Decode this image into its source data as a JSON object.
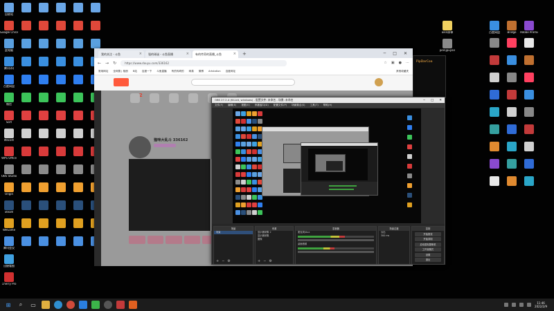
{
  "desktop": {
    "left_icons": [
      {
        "label": "回收站",
        "color": "#6aa6e6"
      },
      {
        "label": "Google Chrome",
        "color": "#e0483a"
      },
      {
        "label": "此电脑",
        "color": "#5aa0e0"
      },
      {
        "label": "腾讯QQ",
        "color": "#3a8fe0"
      },
      {
        "label": "百度网盘",
        "color": "#2f7ff0"
      },
      {
        "label": "微信",
        "color": "#3cc45a"
      },
      {
        "label": "Sort",
        "color": "#e04040"
      },
      {
        "label": "Wacom",
        "color": "#d0d0d0"
      },
      {
        "label": "WPS Office",
        "color": "#d83a3a"
      },
      {
        "label": "OBS Studio",
        "color": "#8b8b8b"
      },
      {
        "label": "Origin",
        "color": "#f0a030"
      },
      {
        "label": "Steam",
        "color": "#2a4f7a"
      },
      {
        "label": "WeGame",
        "color": "#e0a020"
      },
      {
        "label": "腾讯会议",
        "color": "#4a90e2"
      },
      {
        "label": "迅捷看图",
        "color": "#3fa0e0"
      },
      {
        "label": "Cherry Pro",
        "color": "#d03030"
      }
    ],
    "right_icons": [
      {
        "label": "百度网盘",
        "color": "#3a8fe0"
      },
      {
        "label": "ZBrush",
        "color": "#888888"
      },
      {
        "label": "Substance Painter",
        "color": "#c23a3a"
      },
      {
        "label": "Marmoset",
        "color": "#d0d0d0"
      },
      {
        "label": "Adobe Photoshop",
        "color": "#2f6bd6"
      },
      {
        "label": "3ds Max",
        "color": "#2aa6c8"
      },
      {
        "label": "Maya",
        "color": "#35a0a0"
      },
      {
        "label": "Blender",
        "color": "#e08a30"
      },
      {
        "label": "Adobe Premiere",
        "color": "#8a4ad0"
      },
      {
        "label": "Unreal",
        "color": "#e8e8e8"
      },
      {
        "label": "Bridge",
        "color": "#c07030"
      },
      {
        "label": "Toolbag",
        "color": "#ff4060"
      }
    ],
    "mid_labels": [
      "oikn原神",
      "pinnjpuyan",
      "PipDarCoa"
    ]
  },
  "browser": {
    "tabs": [
      {
        "label": "我的关注 - 斗鱼",
        "active": false
      },
      {
        "label": "强的球迷 - 斗鱼直播",
        "active": false
      },
      {
        "label": "有的传奇的直播_斗鱼",
        "active": true
      }
    ],
    "url": "https://www.douyu.com/336162",
    "bookmarks": [
      "常用网址",
      "全网搜 | 相册",
      "B站",
      "百度一下",
      "斗鱼直播",
      "有的传奇的",
      "网易",
      "微博",
      "Artstation",
      "百度网址",
      "其他收藏夹"
    ],
    "streamer_name": "猫咪大乱斗 336162",
    "stat_number": "12"
  },
  "obs": {
    "title": "OBS 27.2.4 (64-bit, windows) - 配置文件: 未命名 - 场景: 未命名",
    "menu": [
      "文件(F)",
      "编辑(E)",
      "视图(V)",
      "停靠窗口(D)",
      "配置文件(P)",
      "场景集合(S)",
      "工具(T)",
      "帮助(H)"
    ],
    "scenes_title": "场景",
    "scenes": [
      "场景"
    ],
    "sources_title": "来源",
    "sources": [
      "显示器采集 2",
      "显示器采集",
      "图像"
    ],
    "mixer_title": "混音器",
    "mixer_channels": [
      {
        "name": "麦克风/Aux",
        "level": 0.62
      },
      {
        "name": "桌面音频",
        "level": 0.48
      }
    ],
    "transitions_title": "场景过渡",
    "transition_name": "淡出",
    "transition_duration": "300 ms",
    "controls_title": "控制",
    "controls": [
      "开始推流",
      "开始录制",
      "启动虚拟摄像机",
      "工作室模式",
      "设置",
      "退出"
    ]
  },
  "taskbar": {
    "time": "11:46",
    "date": "2022/2/9"
  }
}
